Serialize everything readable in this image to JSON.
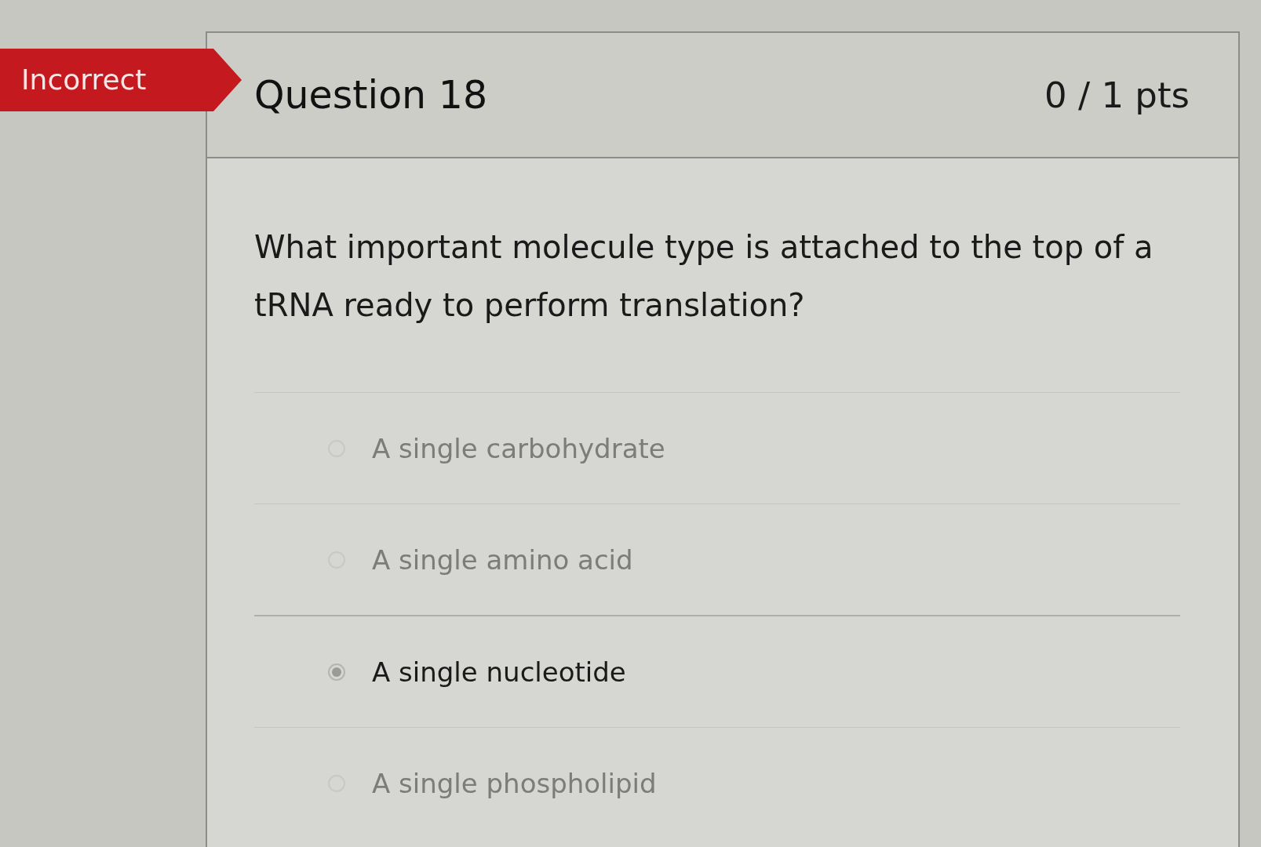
{
  "badge": {
    "label": "Incorrect"
  },
  "question": {
    "title": "Question 18",
    "points": "0 / 1 pts",
    "text": "What important molecule type is attached to the top of a tRNA ready to perform translation?"
  },
  "answers": [
    {
      "label": "A single carbohydrate",
      "selected": false
    },
    {
      "label": "A single amino acid",
      "selected": false
    },
    {
      "label": "A single nucleotide",
      "selected": true
    },
    {
      "label": "A single phospholipid",
      "selected": false
    }
  ]
}
